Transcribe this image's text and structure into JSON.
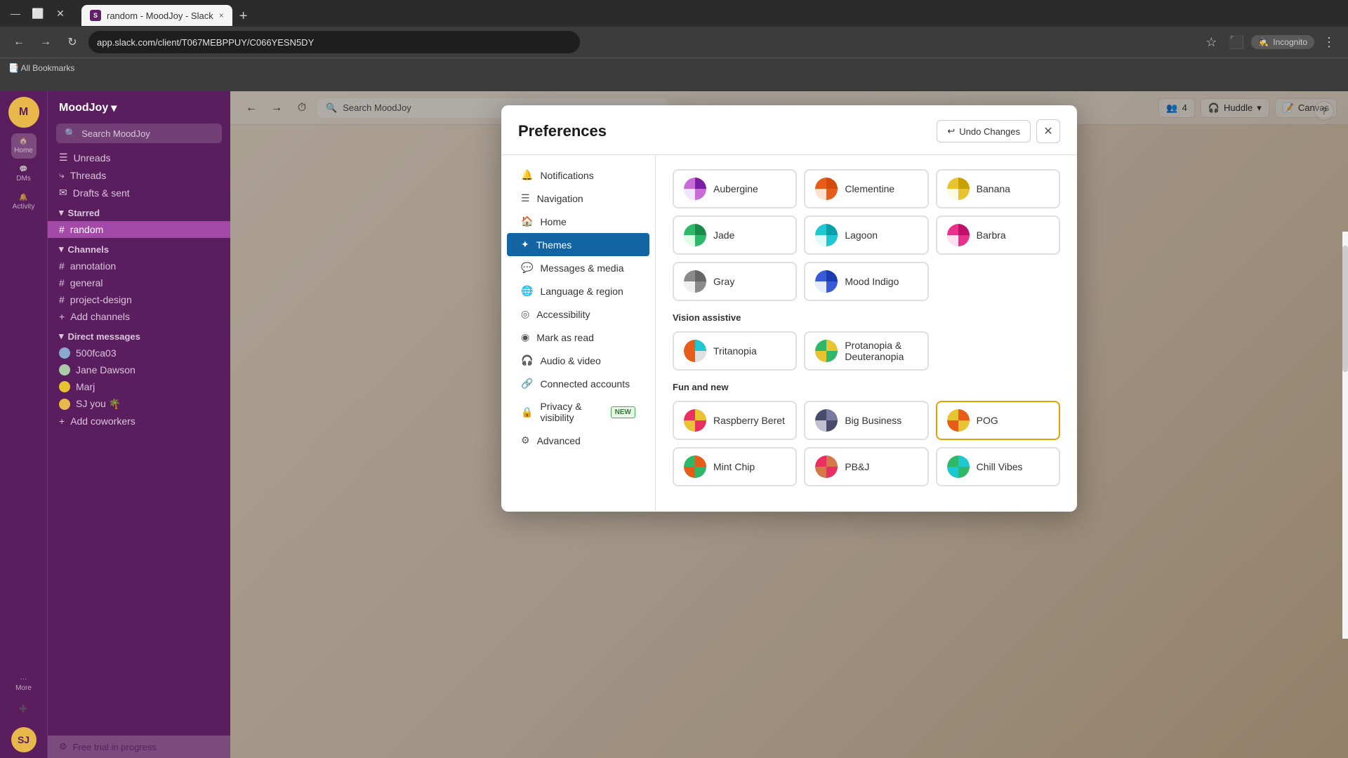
{
  "browser": {
    "title": "random - MoodJoy - Slack",
    "url": "app.slack.com/client/T067MEBPPUY/C066YESN5DY",
    "tab_label": "random - MoodJoy - Slack",
    "back_btn": "←",
    "forward_btn": "→",
    "reload_btn": "↻",
    "new_tab_btn": "+",
    "close_tab_btn": "×",
    "star_btn": "☆",
    "bookmark_btn": "📑",
    "incognito_label": "Incognito",
    "bookmarks_label": "All Bookmarks"
  },
  "slack": {
    "workspace": {
      "name": "MoodJoy",
      "avatar": "M",
      "dropdown_icon": "▾"
    },
    "search_placeholder": "Search MoodJoy",
    "nav_items": [
      {
        "id": "home",
        "label": "Home",
        "icon": "🏠",
        "active": true
      },
      {
        "id": "dms",
        "label": "DMs",
        "icon": "💬"
      },
      {
        "id": "activity",
        "label": "Activity",
        "icon": "🔔"
      }
    ],
    "sidebar": {
      "unreads": "Unreads",
      "threads": "Threads",
      "drafts": "Drafts & sent",
      "starred_label": "Starred",
      "active_channel": "random",
      "channels_label": "Channels",
      "channels": [
        {
          "name": "annotation"
        },
        {
          "name": "general"
        },
        {
          "name": "project-design"
        }
      ],
      "add_channels": "Add channels",
      "dm_label": "Direct messages",
      "dms": [
        {
          "name": "500fca03"
        },
        {
          "name": "Jane Dawson"
        },
        {
          "name": "Marj"
        },
        {
          "name": "SJ   you  🌴"
        }
      ],
      "add_coworkers": "Add coworkers",
      "free_trial": "Free trial in progress"
    },
    "topbar": {
      "back": "←",
      "forward": "→",
      "history": "⏱",
      "search_placeholder": "Search MoodJoy",
      "help_btn": "?",
      "team_count": "4",
      "huddle": "Huddle",
      "canvas": "Canvas"
    }
  },
  "preferences": {
    "title": "Preferences",
    "undo_btn": "Undo Changes",
    "close_btn": "×",
    "nav_items": [
      {
        "id": "notifications",
        "label": "Notifications",
        "icon": "🔔"
      },
      {
        "id": "navigation",
        "label": "Navigation",
        "icon": "☰"
      },
      {
        "id": "home",
        "label": "Home",
        "icon": "🏠"
      },
      {
        "id": "themes",
        "label": "Themes",
        "icon": "✦",
        "active": true
      },
      {
        "id": "messages",
        "label": "Messages & media",
        "icon": "🌐"
      },
      {
        "id": "language",
        "label": "Language & region",
        "icon": "🌐"
      },
      {
        "id": "accessibility",
        "label": "Accessibility",
        "icon": "◎"
      },
      {
        "id": "mark_as_read",
        "label": "Mark as read",
        "icon": "◉"
      },
      {
        "id": "audio_video",
        "label": "Audio & video",
        "icon": "🎧"
      },
      {
        "id": "connected",
        "label": "Connected accounts",
        "icon": "🔗"
      },
      {
        "id": "privacy",
        "label": "Privacy & visibility",
        "icon": "🔒",
        "badge": "NEW"
      },
      {
        "id": "advanced",
        "label": "Advanced",
        "icon": "⚙"
      }
    ],
    "themes": {
      "standard_label": "",
      "themes": [
        {
          "id": "aubergine",
          "name": "Aubergine",
          "colors": [
            "#c86dd7",
            "#7a1fa2",
            "#f0e6ff"
          ],
          "selected": false
        },
        {
          "id": "clementine",
          "name": "Clementine",
          "colors": [
            "#e85c1a",
            "#d44a0a",
            "#ffe0cc"
          ],
          "selected": false
        },
        {
          "id": "banana",
          "name": "Banana",
          "colors": [
            "#e8c430",
            "#c8a000",
            "#fffae0"
          ],
          "selected": false
        },
        {
          "id": "jade",
          "name": "Jade",
          "colors": [
            "#2eb867",
            "#1a8a4a",
            "#e0ffe8"
          ],
          "selected": false
        },
        {
          "id": "lagoon",
          "name": "Lagoon",
          "colors": [
            "#1dc8d0",
            "#0a9fa8",
            "#e0fbfc"
          ],
          "selected": false
        },
        {
          "id": "barbra",
          "name": "Barbra",
          "colors": [
            "#e8318a",
            "#c0106a",
            "#ffe0f0"
          ],
          "selected": false
        },
        {
          "id": "gray",
          "name": "Gray",
          "colors": [
            "#8a8a8a",
            "#666",
            "#f0f0f0"
          ],
          "selected": false
        },
        {
          "id": "mood_indigo",
          "name": "Mood Indigo",
          "colors": [
            "#3a5bd9",
            "#1a3cb0",
            "#e8ecff"
          ],
          "selected": false
        }
      ],
      "vision_assistive_label": "Vision assistive",
      "vision_themes": [
        {
          "id": "tritanopia",
          "name": "Tritanopia",
          "colors": [
            "#e85c1a",
            "#1dc8d0",
            "#e0e0e0"
          ]
        },
        {
          "id": "protanopia",
          "name": "Protanopia & Deuteranopia",
          "colors": [
            "#2eb867",
            "#e8c430",
            "#e0e0e0"
          ]
        }
      ],
      "fun_new_label": "Fun and new",
      "fun_themes": [
        {
          "id": "raspberry_beret",
          "name": "Raspberry Beret",
          "colors": [
            "#e83060",
            "#e8c430",
            "#e0e0e0"
          ]
        },
        {
          "id": "big_business",
          "name": "Big Business",
          "colors": [
            "#4a4a6a",
            "#7a7aa0",
            "#c0c0d0"
          ]
        },
        {
          "id": "pog",
          "name": "POG",
          "colors": [
            "#e8c430",
            "#e85c1a",
            "#e0e0e0"
          ],
          "selected": true
        },
        {
          "id": "mint_chip",
          "name": "Mint Chip",
          "colors": [
            "#2eb867",
            "#e85c1a",
            "#e0e0e0"
          ]
        },
        {
          "id": "pbj",
          "name": "PB&J",
          "colors": [
            "#e83060",
            "#d4784a",
            "#e0e0e0"
          ]
        },
        {
          "id": "chill_vibes",
          "name": "Chill Vibes",
          "colors": [
            "#2eb867",
            "#1dc8d0",
            "#e0e0e0"
          ]
        }
      ]
    }
  }
}
